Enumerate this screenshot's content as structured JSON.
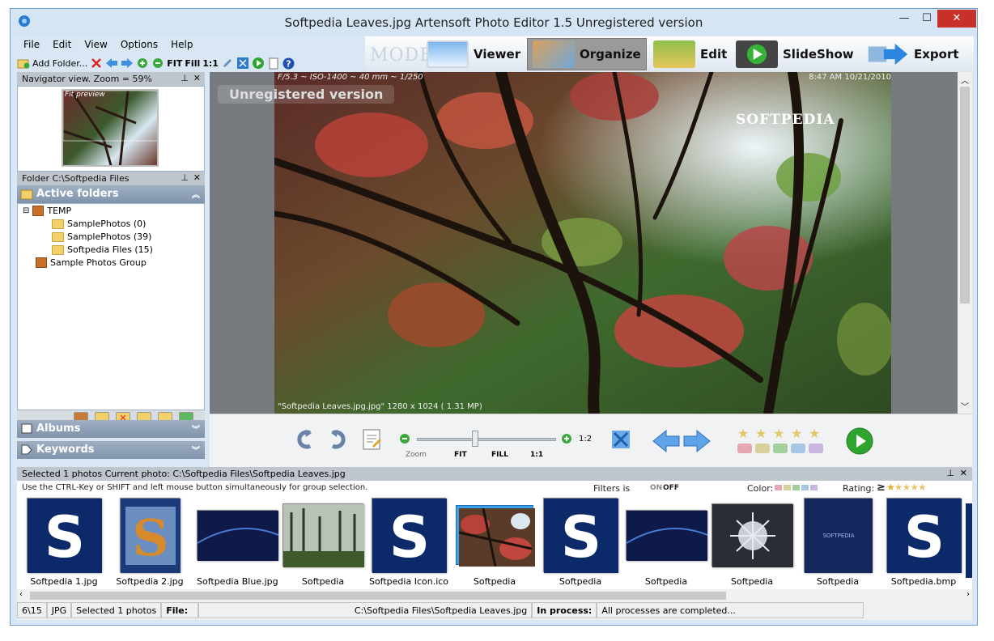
{
  "window": {
    "title": "Softpedia Leaves.jpg     Artensoft Photo Editor 1.5  Unregistered version",
    "min_label": "—",
    "max_label": "☐",
    "close_label": "✕"
  },
  "menu": [
    "File",
    "Edit",
    "View",
    "Options",
    "Help"
  ],
  "toolbar": {
    "add_folder_label": "Add Folder...",
    "fit_label": "FIT",
    "fill_label": "Fill",
    "one_label": "1:1"
  },
  "mode": {
    "label": "MODE:",
    "buttons": [
      {
        "label": "Viewer",
        "selected": false
      },
      {
        "label": "Organize",
        "selected": true
      },
      {
        "label": "Edit",
        "selected": false
      },
      {
        "label": "SlideShow",
        "selected": false
      },
      {
        "label": "Export",
        "selected": false
      }
    ]
  },
  "navigator": {
    "title": "Navigator view. Zoom = 59%",
    "preview_label": "Fit preview"
  },
  "folder": {
    "title": "Folder C:\\Softpedia Files",
    "active_folders_label": "Active folders",
    "tree": [
      {
        "label": "TEMP",
        "type": "group",
        "expander": "⊟"
      },
      {
        "label": "SamplePhotos (0)",
        "type": "folder"
      },
      {
        "label": "SamplePhotos (39)",
        "type": "folder"
      },
      {
        "label": "Softpedia Files (15)",
        "type": "folder"
      },
      {
        "label": "Sample Photos Group",
        "type": "group"
      }
    ]
  },
  "albums_label": "Albums",
  "keywords_label": "Keywords",
  "viewer": {
    "exif": "F/5.3 ~ ISO-1400 ~ 40 mm ~ 1/250",
    "datetime": "8:47 AM 10/21/2010",
    "unregistered": "Unregistered version",
    "watermark": "SOFTPEDIA",
    "caption": "\"Softpedia Leaves.jpg.jpg\" 1280 x 1024 ( 1.31 MP)"
  },
  "controls": {
    "zoom_label": "Zoom",
    "fit_label": "FIT",
    "fill_label": "FILL",
    "one_label": "1:1",
    "ratio_label": "1:2",
    "slider_value": 0.42,
    "rating": 0
  },
  "selection": {
    "header": "Selected 1  photos    Current photo:   C:\\Softpedia Files\\Softpedia Leaves.jpg",
    "hint": "Use the CTRL-Key or SHIFT and  left mouse button simultaneously for group selection.",
    "filters_label": "Filters is",
    "on_label": "ON",
    "off_label": "OFF",
    "color_label": "Color:",
    "rating_label": "Rating:",
    "rating_symbol": "≥"
  },
  "thumbnails": [
    {
      "name": "Softpedia 1.jpg",
      "kind": "s-logo"
    },
    {
      "name": "Softpedia 2.jpg",
      "kind": "s-fancy"
    },
    {
      "name": "Softpedia Blue.jpg",
      "kind": "blue-wide"
    },
    {
      "name": "Softpedia",
      "kind": "forest"
    },
    {
      "name": "Softpedia Icon.ico",
      "kind": "s-logo"
    },
    {
      "name": "Softpedia",
      "kind": "leaves",
      "selected": true
    },
    {
      "name": "Softpedia",
      "kind": "s-logo"
    },
    {
      "name": "Softpedia",
      "kind": "blue-wide"
    },
    {
      "name": "Softpedia",
      "kind": "gray-burst"
    },
    {
      "name": "Softpedia",
      "kind": "blue-dark"
    },
    {
      "name": "Softpedia.bmp",
      "kind": "s-logo"
    }
  ],
  "status": {
    "count": "6\\15",
    "format": "JPG",
    "selected": "Selected 1 photos",
    "file_label": "File:",
    "file_path": "C:\\Softpedia Files\\Softpedia Leaves.jpg",
    "process_label": "In process:",
    "process_text": "All processes are completed..."
  }
}
